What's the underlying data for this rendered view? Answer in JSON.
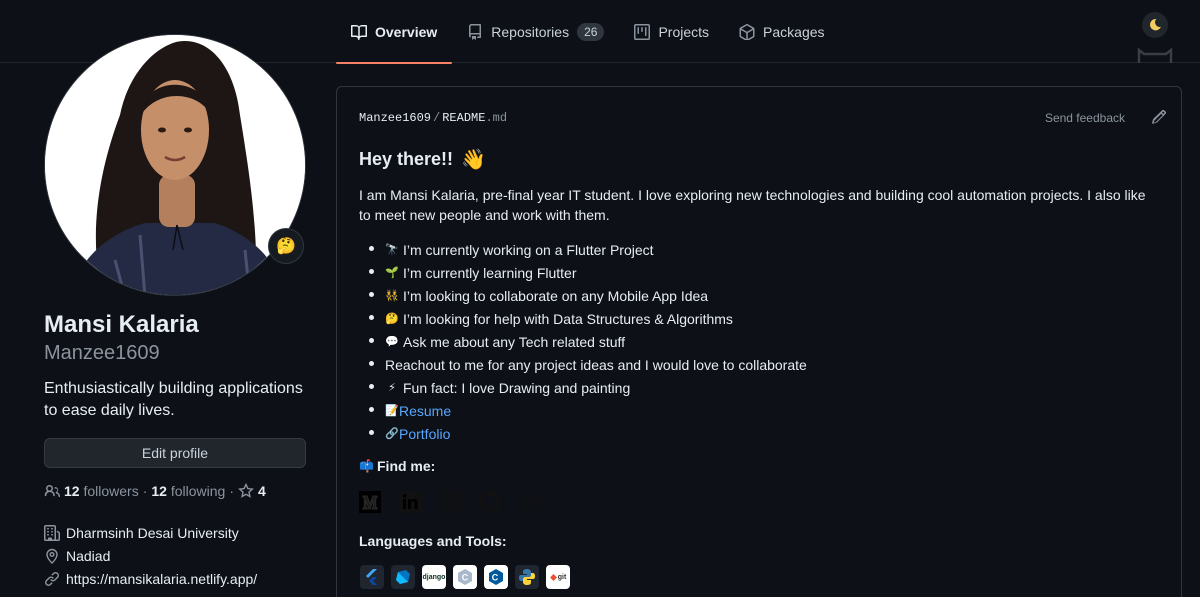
{
  "tabs": [
    {
      "label": "Overview",
      "icon": "book-icon",
      "active": true
    },
    {
      "label": "Repositories",
      "icon": "repo-icon",
      "count": "26"
    },
    {
      "label": "Projects",
      "icon": "project-icon"
    },
    {
      "label": "Packages",
      "icon": "package-icon"
    }
  ],
  "profile": {
    "fullname": "Mansi Kalaria",
    "username": "Manzee1609",
    "bio": "Enthusiastically building applications to ease daily lives.",
    "status_emoji": "🤔",
    "edit_label": "Edit profile",
    "followers_count": "12",
    "followers_label": "followers",
    "dot": "·",
    "following_count": "12",
    "following_label": "following",
    "stars_count": "4",
    "organization": "Dharmsinh Desai University",
    "location": "Nadiad",
    "website": "https://mansikalaria.netlify.app/"
  },
  "readme": {
    "owner": "Manzee1609",
    "separator": "/",
    "filename": "README",
    "extension": ".md",
    "feedback": "Send feedback",
    "heading": "Hey there!!",
    "heading_emoji": "👋",
    "intro": "I am Mansi Kalaria, pre-final year IT student. I love exploring new technologies and building cool automation projects. I also like to meet new people and work with them.",
    "items": [
      {
        "emoji": "🔭",
        "text": "I’m currently working on a Flutter Project"
      },
      {
        "emoji": "🌱",
        "text": "I’m currently learning Flutter"
      },
      {
        "emoji": "👯",
        "text": "I’m looking to collaborate on any Mobile App Idea"
      },
      {
        "emoji": "🤔",
        "text": "I’m looking for help with Data Structures & Algorithms"
      },
      {
        "emoji": "💬",
        "text": "Ask me about any Tech related stuff"
      },
      {
        "emoji": "",
        "text": "Reachout to me for any project ideas and I would love to collaborate"
      },
      {
        "emoji": "⚡",
        "text": "Fun fact: I love Drawing and painting"
      },
      {
        "emoji": "📝",
        "text": "Resume",
        "link": true
      },
      {
        "emoji": "🔗",
        "text": "Portfolio",
        "link": true
      }
    ],
    "find_me_emoji": "📫",
    "find_me": "Find me:",
    "social_icons": [
      "medium-icon",
      "linkedin-icon",
      "instagram-icon",
      "github-icon",
      "gitlab-icon"
    ],
    "languages_title": "Languages and Tools:",
    "tools": [
      {
        "icon": "flutter-icon",
        "label": ""
      },
      {
        "icon": "dart-icon",
        "label": ""
      },
      {
        "icon": "django-icon",
        "label": "django"
      },
      {
        "icon": "c-icon",
        "label": "C"
      },
      {
        "icon": "cplusplus-icon",
        "label": "C"
      },
      {
        "icon": "python-icon",
        "label": ""
      },
      {
        "icon": "git-icon",
        "label": "git"
      }
    ]
  }
}
